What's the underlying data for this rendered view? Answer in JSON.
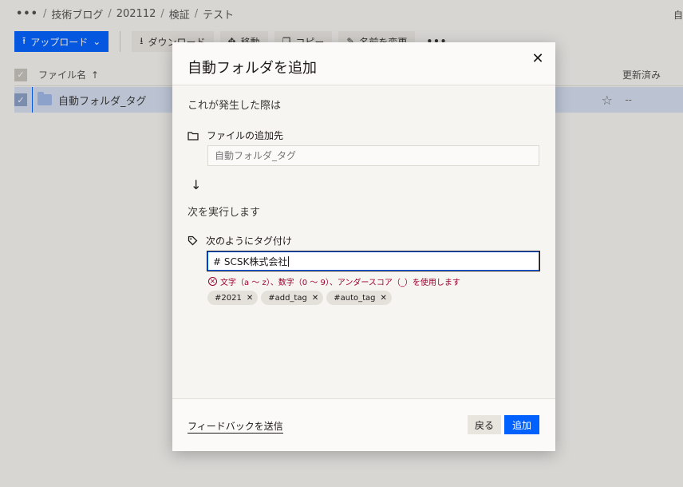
{
  "breadcrumb": {
    "more": "•••",
    "items": [
      "技術ブログ",
      "202112",
      "検証",
      "テスト"
    ]
  },
  "corner_letter": "自",
  "toolbar": {
    "upload_label": "アップロード",
    "download_label": "ダウンロード",
    "move_label": "移動",
    "copy_label": "コピー",
    "rename_label": "名前を変更",
    "more_label": "•••"
  },
  "list": {
    "header_name": "ファイル名",
    "header_sort": "↑",
    "header_modified": "更新済み",
    "row_name": "自動フォルダ_タグ",
    "row_modified": "--"
  },
  "modal": {
    "title": "自動フォルダを追加",
    "close": "✕",
    "when_label": "これが発生した際は",
    "dest_label": "ファイルの追加先",
    "dest_placeholder": "自動フォルダ_タグ",
    "arrow": "↓",
    "then_label": "次を実行します",
    "tag_label": "次のようにタグ付け",
    "tag_value": "# SCSK株式会社",
    "error_icon": "✕",
    "error_text": "文字（a ～ z）、数字（0 ～ 9）、アンダースコア（_）を使用します",
    "chips": [
      {
        "label": "#2021"
      },
      {
        "label": "#add_tag"
      },
      {
        "label": "#auto_tag"
      }
    ],
    "chip_remove": "✕",
    "feedback": "フィードバックを送信",
    "back": "戻る",
    "add": "追加"
  },
  "colors": {
    "accent": "#0061fe",
    "error": "#9b0032"
  }
}
